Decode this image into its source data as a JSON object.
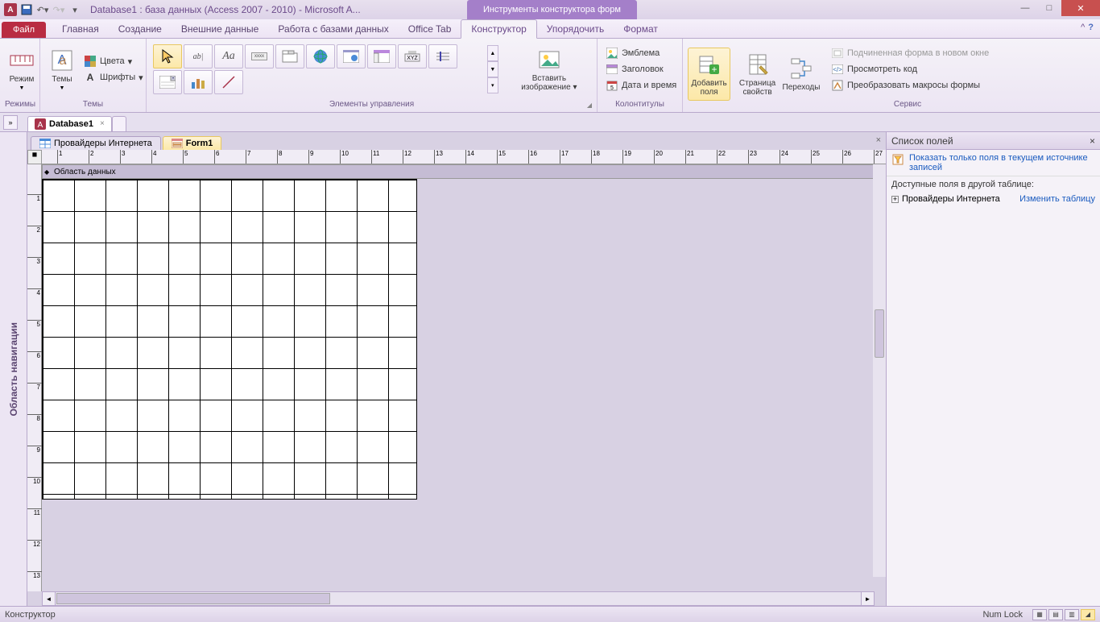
{
  "titlebar": {
    "app_letter": "A",
    "title": "Database1 : база данных (Access 2007 - 2010)  -  Microsoft A...",
    "context_tab": "Инструменты конструктора форм"
  },
  "tabs": {
    "file": "Файл",
    "items": [
      "Главная",
      "Создание",
      "Внешние данные",
      "Работа с базами данных",
      "Office Tab",
      "Конструктор",
      "Упорядочить",
      "Формат"
    ],
    "active_index": 5
  },
  "ribbon": {
    "group_modes": "Режимы",
    "btn_mode": "Режим",
    "group_themes": "Темы",
    "btn_themes": "Темы",
    "btn_colors": "Цвета",
    "btn_fonts": "Шрифты",
    "group_controls": "Элементы управления",
    "btn_insert_image": "Вставить изображение",
    "group_headers": "Колонтитулы",
    "btn_emblem": "Эмблема",
    "btn_title": "Заголовок",
    "btn_datetime": "Дата и время",
    "group_tools_inner": "",
    "btn_add_fields": "Добавить поля",
    "btn_prop_sheet": "Страница свойств",
    "btn_tab_order": "Переходы",
    "group_service": "Сервис",
    "btn_subform": "Подчиненная форма в новом окне",
    "btn_view_code": "Просмотреть код",
    "btn_convert_macros": "Преобразовать макросы формы"
  },
  "doctabs": {
    "db": "Database1"
  },
  "navpane": {
    "label": "Область навигации"
  },
  "objtabs": {
    "tab1": "Провайдеры Интернета",
    "tab2": "Form1"
  },
  "design": {
    "section_detail": "Область данных"
  },
  "fieldpane": {
    "title": "Список полей",
    "show_current": "Показать только поля в текущем источнике записей",
    "available": "Доступные поля в другой таблице:",
    "table1": "Провайдеры Интернета",
    "edit": "Изменить таблицу"
  },
  "statusbar": {
    "mode": "Конструктор",
    "numlock": "Num Lock"
  }
}
